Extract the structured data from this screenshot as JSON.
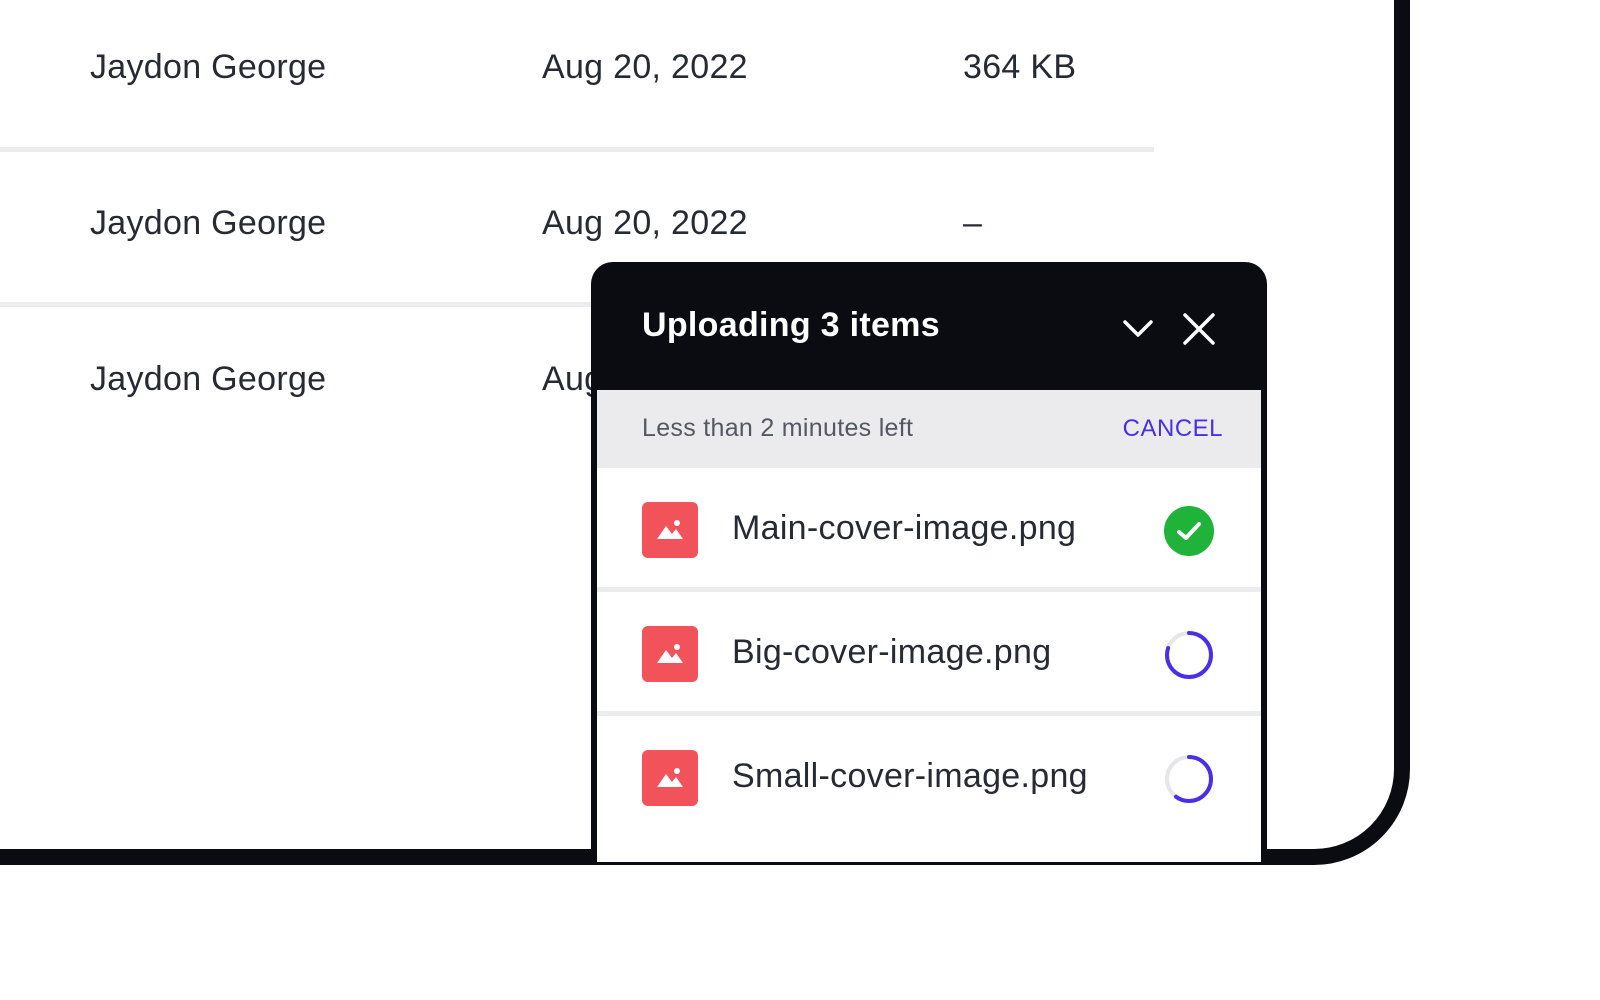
{
  "table": {
    "rows": [
      {
        "owner": "Jaydon George",
        "date": "Aug 20, 2022",
        "size": "364 KB"
      },
      {
        "owner": "Jaydon George",
        "date": "Aug 20, 2022",
        "size": "–"
      },
      {
        "owner": "Jaydon George",
        "date": "Aug 20, 2022",
        "size": ""
      }
    ]
  },
  "upload_panel": {
    "title": "Uploading 3 items",
    "status_text": "Less than 2 minutes left",
    "cancel_label": "CANCEL",
    "files": [
      {
        "name": "Main-cover-image.png",
        "status": "complete",
        "progress": 1.0
      },
      {
        "name": "Big-cover-image.png",
        "status": "uploading",
        "progress": 0.8
      },
      {
        "name": "Small-cover-image.png",
        "status": "uploading",
        "progress": 0.6
      }
    ]
  },
  "icons": {
    "collapse": "chevron-down-icon",
    "close": "close-icon",
    "file": "image-icon",
    "done": "check-circle-icon",
    "progress": "progress-ring-icon"
  },
  "colors": {
    "accent": "#4a2ee8",
    "success": "#1fb33a",
    "file_icon": "#f2525a",
    "panel_dark": "#0b0c12"
  }
}
